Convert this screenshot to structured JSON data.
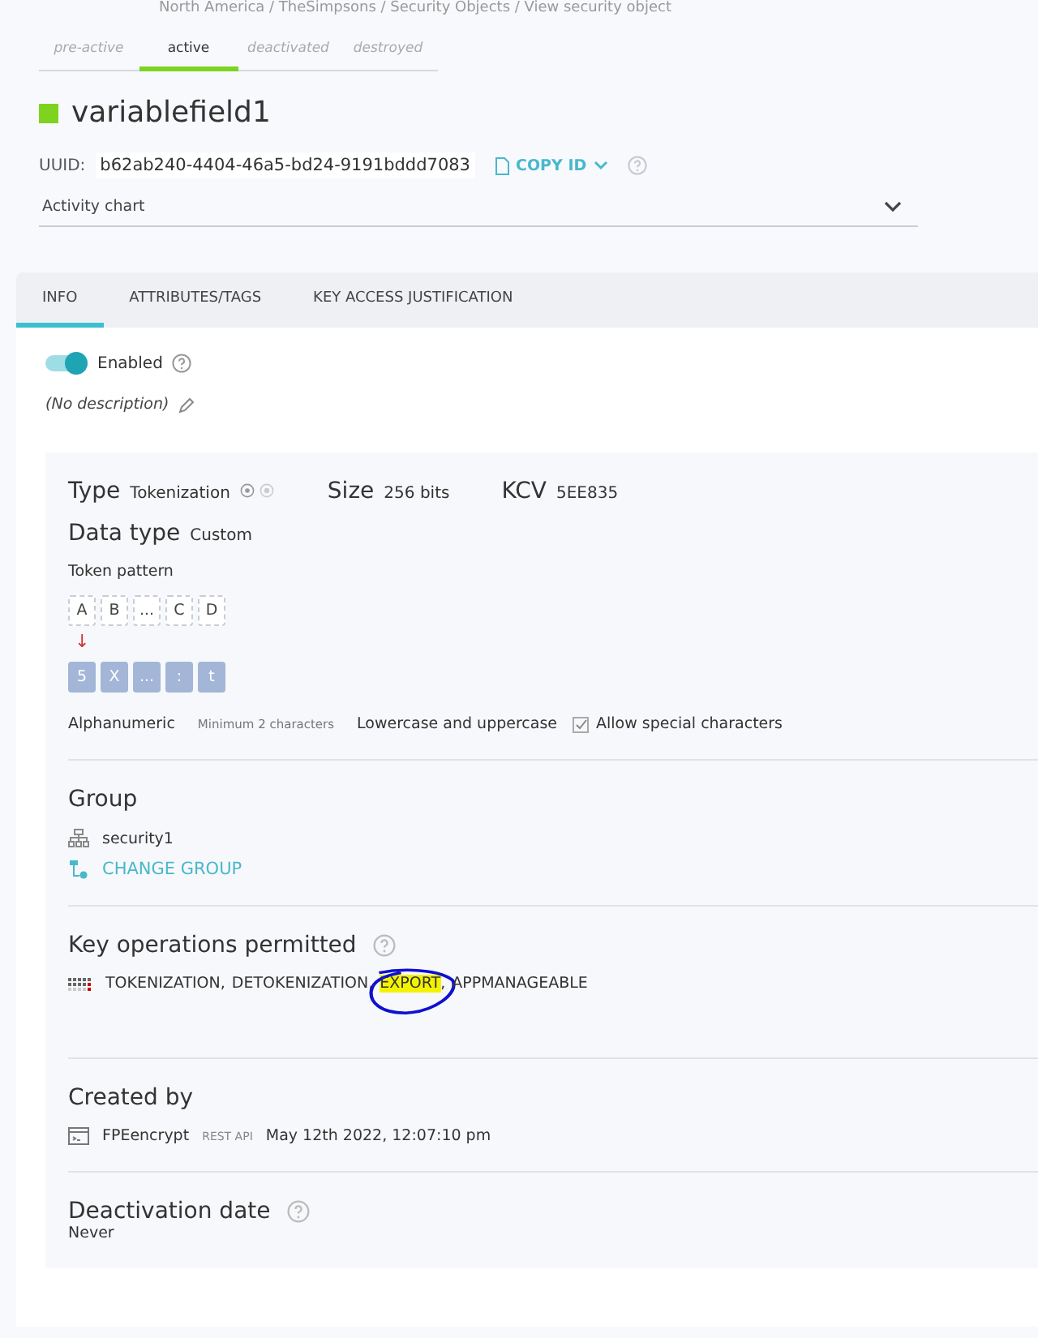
{
  "breadcrumb": "North America / TheSimpsons / Security Objects / View security object",
  "state_tabs": [
    {
      "label": "pre-active",
      "selected": false
    },
    {
      "label": "active",
      "selected": true
    },
    {
      "label": "deactivated",
      "selected": false
    },
    {
      "label": "destroyed",
      "selected": false
    }
  ],
  "object": {
    "name": "variablefield1",
    "uuid_label": "UUID:",
    "uuid": "b62ab240-4404-46a5-bd24-9191bddd7083",
    "copy_button": "COPY ID"
  },
  "activity_chart": {
    "label": "Activity chart",
    "expanded": false
  },
  "tabs": [
    {
      "label": "INFO",
      "selected": true
    },
    {
      "label": "ATTRIBUTES/TAGS",
      "selected": false
    },
    {
      "label": "KEY ACCESS JUSTIFICATION",
      "selected": false
    }
  ],
  "enabled": {
    "label": "Enabled",
    "on": true
  },
  "description": "(No description)",
  "details": {
    "type_label": "Type",
    "type": "Tokenization",
    "size_label": "Size",
    "size": "256 bits",
    "kcv_label": "KCV",
    "kcv": "5EE835",
    "data_type_label": "Data type",
    "data_type": "Custom",
    "token_pattern_label": "Token pattern",
    "input_chars": [
      "A",
      "B",
      "...",
      "C",
      "D"
    ],
    "arrow": "↓",
    "output_chars": [
      "5",
      "X",
      "...",
      ":",
      "t"
    ],
    "charset": "Alphanumeric",
    "min_length": "Minimum 2 characters",
    "case": "Lowercase and uppercase",
    "special": {
      "label": "Allow special characters",
      "checked": true
    }
  },
  "group": {
    "title": "Group",
    "name": "security1",
    "change_button": "CHANGE GROUP"
  },
  "operations": {
    "title": "Key operations permitted",
    "items": [
      {
        "label": "TOKENIZATION",
        "suffix": ",",
        "highlighted": false,
        "circled": false
      },
      {
        "label": "DETOKENIZATION",
        "suffix": ",",
        "highlighted": false,
        "circled": false
      },
      {
        "label": "EXPORT",
        "suffix": ",",
        "highlighted": true,
        "circled": true
      },
      {
        "label": "APPMANAGEABLE",
        "highlighted": false,
        "circled": false
      }
    ]
  },
  "created": {
    "title": "Created by",
    "name": "FPEencrypt",
    "source": "REST API",
    "date": "May 12th 2022, 12:07:10 pm"
  },
  "deactivation": {
    "title": "Deactivation date",
    "value": "Never"
  }
}
